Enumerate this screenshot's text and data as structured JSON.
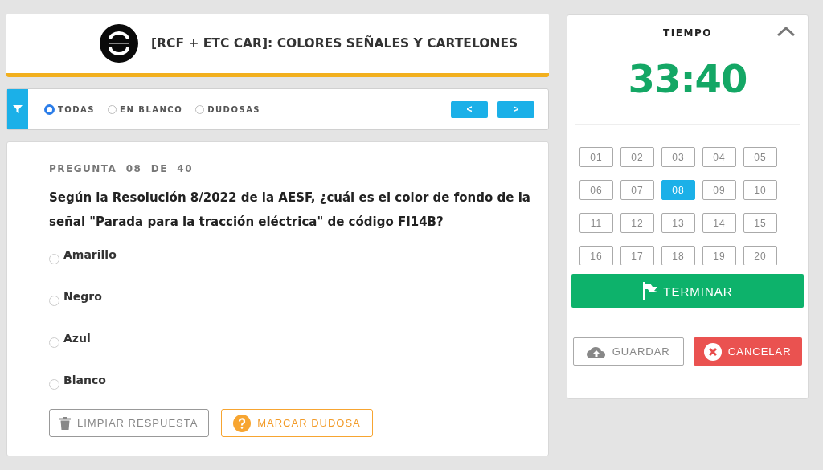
{
  "header": {
    "title": "[RCF + ETC CAR]: COLORES SEÑALES Y CARTELONES"
  },
  "filters": [
    {
      "label": "TODAS",
      "selected": true
    },
    {
      "label": "EN BLANCO",
      "selected": false
    },
    {
      "label": "DUDOSAS",
      "selected": false
    }
  ],
  "nav_buttons": [
    "<",
    ">"
  ],
  "question": {
    "counter": "PREGUNTA  08  DE  40",
    "text": "Según la Resolución 8/2022 de la AESF, ¿cuál es el color de fondo de la señal \"Parada para la tracción eléctrica\" de código FI14B?",
    "options": [
      {
        "label": "Amarillo",
        "selected": false
      },
      {
        "label": "Negro",
        "selected": false
      },
      {
        "label": "Azul",
        "selected": false
      },
      {
        "label": "Blanco",
        "selected": false
      }
    ],
    "clear_button": "LIMPIAR RESPUESTA",
    "doubt_button": "MARCAR DUDOSA"
  },
  "timer": {
    "title": "TIEMPO",
    "time": "33:40"
  },
  "question_numbers": [
    {
      "label": "01",
      "selected": false
    },
    {
      "label": "02",
      "selected": false
    },
    {
      "label": "03",
      "selected": false
    },
    {
      "label": "04",
      "selected": false
    },
    {
      "label": "05",
      "selected": false
    },
    {
      "label": "06",
      "selected": false
    },
    {
      "label": "07",
      "selected": false
    },
    {
      "label": "08",
      "selected": true
    },
    {
      "label": "09",
      "selected": false
    },
    {
      "label": "10",
      "selected": false
    },
    {
      "label": "11",
      "selected": false
    },
    {
      "label": "12",
      "selected": false
    },
    {
      "label": "13",
      "selected": false
    },
    {
      "label": "14",
      "selected": false
    },
    {
      "label": "15",
      "selected": false
    },
    {
      "label": "16",
      "selected": false
    },
    {
      "label": "17",
      "selected": false
    },
    {
      "label": "18",
      "selected": false
    },
    {
      "label": "19",
      "selected": false
    },
    {
      "label": "20",
      "selected": false
    }
  ],
  "finish_button": "TERMINAR",
  "save_button": "GUARDAR",
  "cancel_button": "CANCELAR"
}
